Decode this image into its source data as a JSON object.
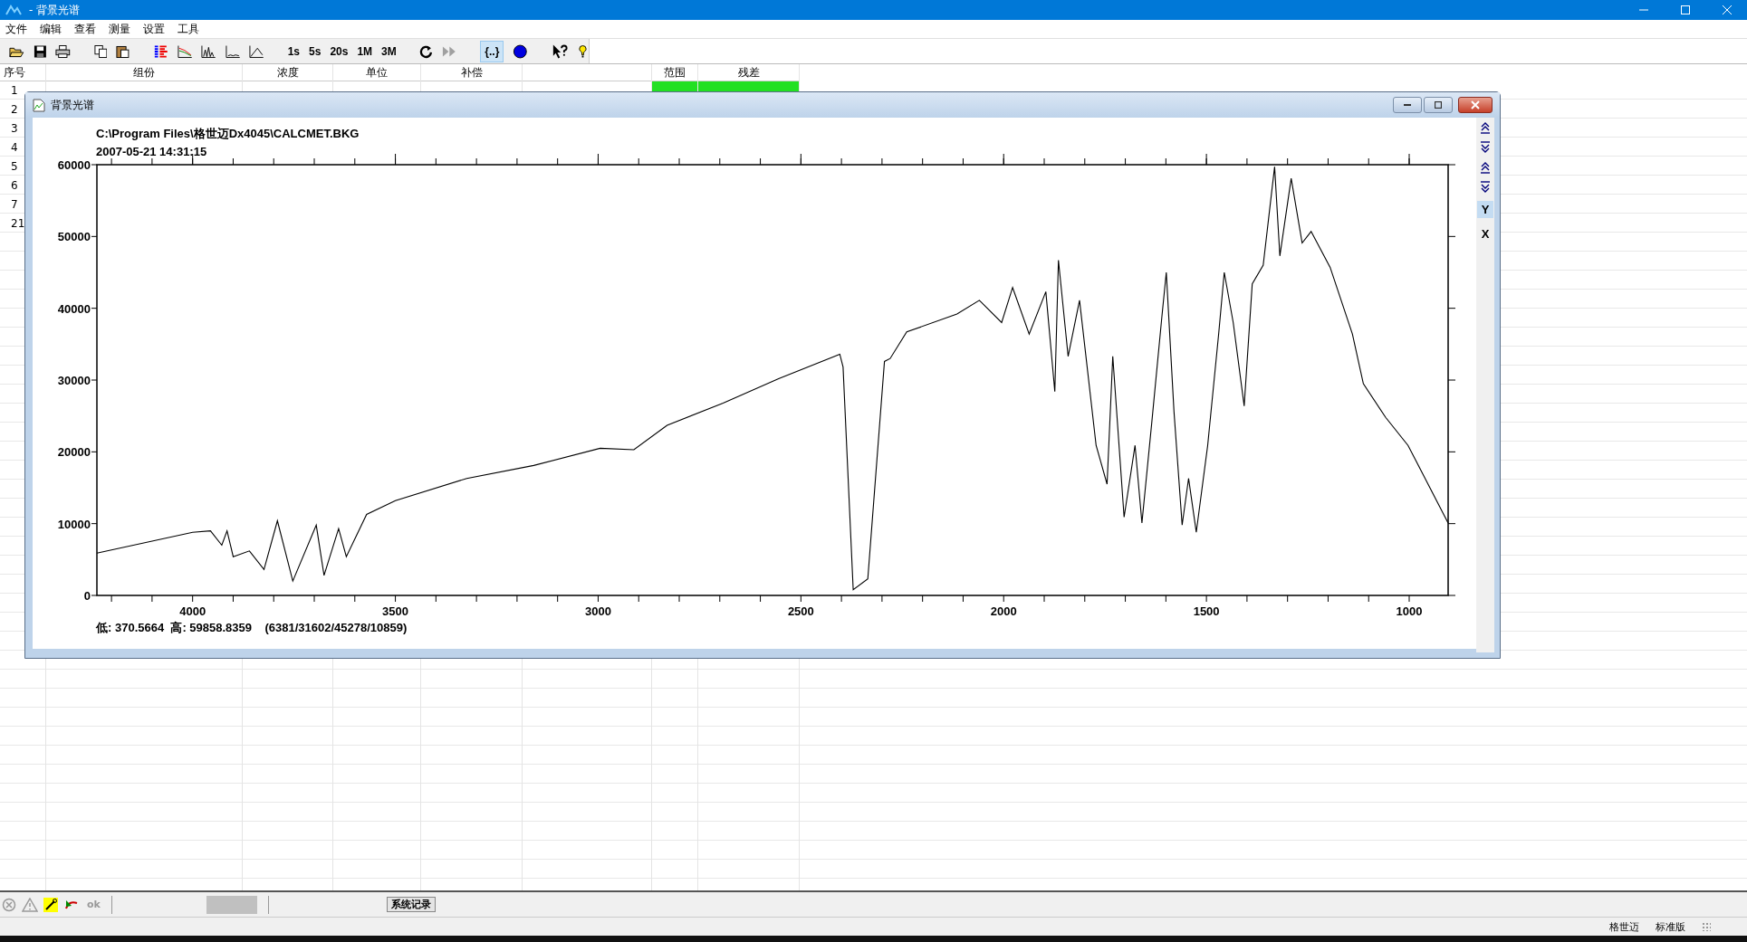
{
  "window": {
    "title": "- 背景光谱"
  },
  "menu": [
    "文件",
    "编辑",
    "查看",
    "测量",
    "设置",
    "工具"
  ],
  "toolbar": {
    "time_buttons": [
      "1s",
      "5s",
      "20s",
      "1M",
      "3M"
    ],
    "forward_disabled": true,
    "bracket_button": {
      "label": "{..}",
      "selected": true
    }
  },
  "table": {
    "columns": [
      "序号",
      "组份",
      "浓度",
      "单位",
      "补偿",
      "",
      "范围",
      "残差"
    ],
    "rows": [
      {
        "number": "1",
        "highlights": [
          {
            "color": "#22e022"
          },
          {
            "color": "#22e022"
          }
        ]
      },
      {
        "number": "2"
      },
      {
        "number": "3"
      },
      {
        "number": "4"
      },
      {
        "number": "5"
      },
      {
        "number": "6"
      },
      {
        "number": "7"
      },
      {
        "number": "21"
      }
    ]
  },
  "child_window": {
    "title": "背景光谱",
    "file_path": "C:\\Program Files\\格世迈Dx4045\\CALCMET.BKG",
    "timestamp": "2007-05-21 14:31:15",
    "stats": "低: 370.5664  高: 59858.8359    (6381/31602/45278/10859)",
    "axis_buttons": [
      {
        "label": "Y",
        "selected": true
      },
      {
        "label": "X",
        "selected": false
      }
    ],
    "chart_data": {
      "type": "line",
      "xlim": [
        4236,
        904
      ],
      "ylim": [
        0,
        60000
      ],
      "xticks": [
        4000,
        3500,
        3000,
        2500,
        2000,
        1500,
        1000
      ],
      "yticks": [
        0,
        10000,
        20000,
        30000,
        40000,
        50000,
        60000
      ],
      "x": [
        4236,
        4000,
        3956,
        3928,
        3915,
        3900,
        3860,
        3824,
        3791,
        3753,
        3695,
        3676,
        3640,
        3621,
        3571,
        3500,
        3324,
        3159,
        2995,
        2912,
        2830,
        2692,
        2555,
        2404,
        2396,
        2371,
        2335,
        2294,
        2280,
        2239,
        2115,
        2060,
        2005,
        1978,
        1937,
        1896,
        1874,
        1865,
        1841,
        1813,
        1772,
        1745,
        1731,
        1703,
        1676,
        1659,
        1635,
        1610,
        1599,
        1580,
        1560,
        1544,
        1525,
        1497,
        1470,
        1456,
        1434,
        1407,
        1387,
        1360,
        1338,
        1332,
        1319,
        1291,
        1264,
        1242,
        1195,
        1140,
        1113,
        1058,
        1003,
        904
      ],
      "series": [
        {
          "color": "#000000",
          "values": [
            5900,
            8800,
            9000,
            7000,
            9000,
            5400,
            6200,
            3600,
            10400,
            2000,
            9800,
            2800,
            9300,
            5400,
            11300,
            13200,
            16300,
            18100,
            20500,
            20300,
            23700,
            26800,
            30200,
            33600,
            31800,
            800,
            2300,
            32600,
            33000,
            36700,
            39200,
            41100,
            38000,
            42900,
            36400,
            42300,
            28400,
            46700,
            33300,
            41100,
            20900,
            15500,
            33300,
            10900,
            20900,
            10100,
            24000,
            38800,
            45000,
            25600,
            9800,
            16300,
            8800,
            20900,
            36400,
            45000,
            38000,
            26400,
            43400,
            46000,
            56800,
            59700,
            47300,
            58100,
            49100,
            50700,
            45700,
            36400,
            29500,
            24800,
            20900,
            10100
          ]
        }
      ]
    }
  },
  "status": {
    "ok": "ok",
    "log_button": "系统记录",
    "company": "格世迈",
    "edition": "标准版"
  }
}
